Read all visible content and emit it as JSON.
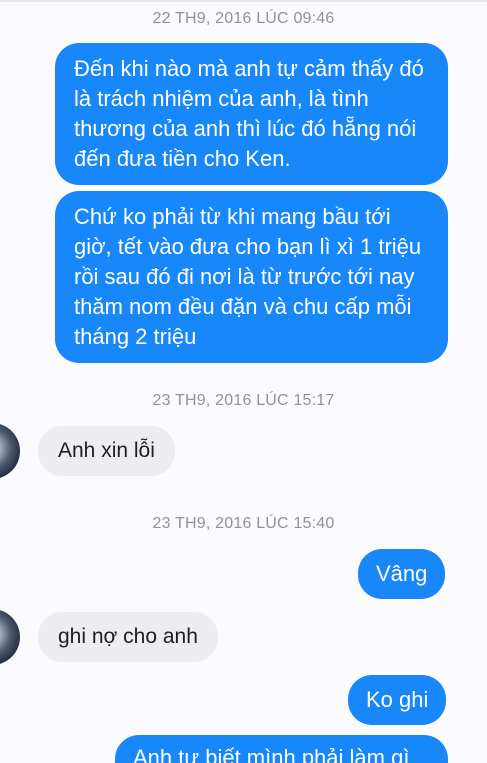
{
  "conversation": {
    "timestamps": [
      "22 TH9, 2016 LÚC 09:46",
      "23 TH9, 2016 LÚC 15:17",
      "23 TH9, 2016 LÚC 15:40"
    ],
    "messages": [
      {
        "direction": "outgoing",
        "text": "Đến khi nào mà anh tự cảm thấy đó là trách nhiệm của anh, là tình thương của anh thì lúc đó hẵng nói đến đưa tiền cho Ken."
      },
      {
        "direction": "outgoing",
        "text": "Chứ ko phải từ khi mang bầu tới giờ, tết vào đưa cho bạn lì xì 1 triệu rồi sau đó đi nơi là từ trước tới nay thăm nom đều đặn và chu cấp mỗi tháng 2 triệu"
      },
      {
        "direction": "incoming",
        "text": "Anh xin lỗi"
      },
      {
        "direction": "outgoing",
        "text": "Vâng"
      },
      {
        "direction": "incoming",
        "text": "ghi nợ cho anh"
      },
      {
        "direction": "outgoing",
        "text": "Ko ghi"
      },
      {
        "direction": "outgoing",
        "text": "Anh tự biết mình phải làm gì"
      }
    ]
  },
  "colors": {
    "outgoing_bubble": "#1787f9",
    "incoming_bubble": "#ededf0",
    "timestamp_text": "#8d939c"
  },
  "icons": {
    "avatar": "contact-avatar-icon"
  }
}
